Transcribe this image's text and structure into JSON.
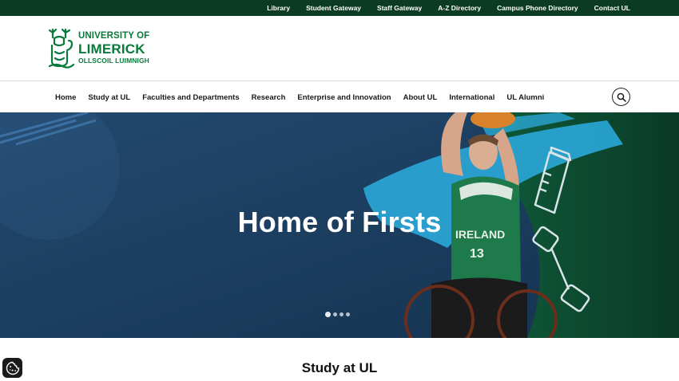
{
  "utility_nav": {
    "items": [
      {
        "label": "Library"
      },
      {
        "label": "Student Gateway"
      },
      {
        "label": "Staff Gateway"
      },
      {
        "label": "A-Z Directory"
      },
      {
        "label": "Campus Phone Directory"
      },
      {
        "label": "Contact UL"
      }
    ]
  },
  "logo": {
    "line1": "UNIVERSITY OF",
    "line2": "LIMERICK",
    "line3": "OLLSCOIL LUIMNIGH"
  },
  "main_nav": {
    "items": [
      {
        "label": "Home"
      },
      {
        "label": "Study at UL"
      },
      {
        "label": "Faculties and Departments"
      },
      {
        "label": "Research"
      },
      {
        "label": "Enterprise and Innovation"
      },
      {
        "label": "About UL"
      },
      {
        "label": "International"
      },
      {
        "label": "UL Alumni"
      }
    ]
  },
  "hero": {
    "title": "Home of Firsts",
    "jersey_text": "IRELAND",
    "jersey_number": "13",
    "slide_count": 4,
    "active_slide": 1
  },
  "section": {
    "title": "Study at UL"
  },
  "icons": {
    "search": "search-icon",
    "cookie": "cookie-icon"
  },
  "colors": {
    "utility_bar": "#0b3b22",
    "brand_green": "#0a7a3b",
    "hero_blue": "#1d3f66",
    "hero_green": "#0e4a35"
  }
}
